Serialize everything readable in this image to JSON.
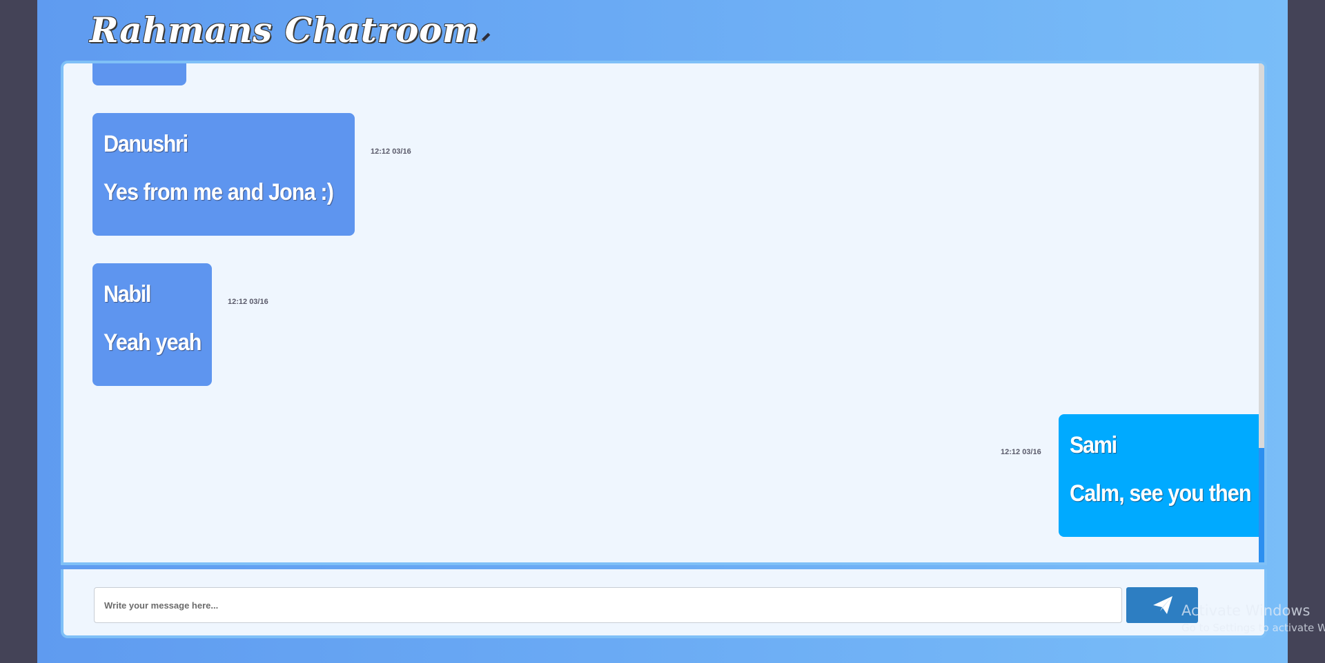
{
  "header": {
    "title": "Rahmans Chatroom",
    "edit_icon": "pencil-icon"
  },
  "messages": [
    {
      "sender": "Danushri",
      "text": "Yes from me and Jona :)",
      "time": "12:12 03/16",
      "own": false
    },
    {
      "sender": "Nabil",
      "text": "Yeah yeah",
      "time": "12:12 03/16",
      "own": false
    },
    {
      "sender": "Sami",
      "text": "Calm, see you then",
      "time": "12:12 03/16",
      "own": true
    }
  ],
  "composer": {
    "placeholder": "Write your message here...",
    "value": "",
    "send_icon": "paper-plane-icon"
  },
  "watermark": {
    "line1": "Activate Windows",
    "line2": "Go to Settings to activate W"
  },
  "colors": {
    "other_bubble": "#5e95ef",
    "own_bubble": "#00aaff",
    "send_button": "#2d7ec2",
    "panel_border": "#7fc0f7"
  }
}
